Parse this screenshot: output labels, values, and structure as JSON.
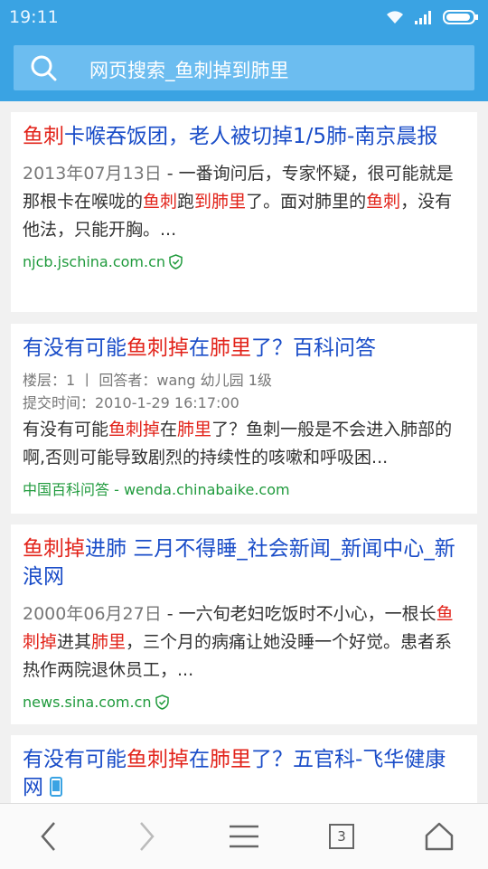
{
  "status_bar": {
    "time": "19:11",
    "icons": [
      "wifi-icon",
      "signal-icon",
      "battery-icon"
    ]
  },
  "search": {
    "query": "网页搜索_鱼刺掉到肺里",
    "icon": "search-icon"
  },
  "results": [
    {
      "title_segments": [
        {
          "text": "鱼刺",
          "hl": true
        },
        {
          "text": "卡喉吞饭团，老人被切掉1/5肺-南京晨报",
          "hl": false
        }
      ],
      "date": "2013年07月13日",
      "snippet_segments": [
        {
          "text": " - 一番询问后，专家怀疑，很可能就是那根卡在喉咙的",
          "hl": false
        },
        {
          "text": "鱼刺",
          "hl": true
        },
        {
          "text": "跑",
          "hl": false
        },
        {
          "text": "到肺里",
          "hl": true
        },
        {
          "text": "了。面对肺里的",
          "hl": false
        },
        {
          "text": "鱼刺",
          "hl": true
        },
        {
          "text": "，没有他法，只能开胸。...",
          "hl": false
        }
      ],
      "source": "njcb.jschina.com.cn",
      "verified": true
    },
    {
      "title_segments": [
        {
          "text": "有没有可能",
          "hl": false
        },
        {
          "text": "鱼刺掉",
          "hl": true
        },
        {
          "text": "在",
          "hl": false
        },
        {
          "text": "肺里",
          "hl": true
        },
        {
          "text": "了？百科问答",
          "hl": false
        }
      ],
      "meta_line1": "楼层：1 丨 回答者：wang 幼儿园 1级",
      "meta_line2": "提交时间：2010-1-29 16:17:00",
      "snippet_segments": [
        {
          "text": "有没有可能",
          "hl": false
        },
        {
          "text": "鱼刺掉",
          "hl": true
        },
        {
          "text": "在",
          "hl": false
        },
        {
          "text": "肺里",
          "hl": true
        },
        {
          "text": "了？鱼刺一般是不会进入肺部的啊,否则可能导致剧烈的持续性的咳嗽和呼吸困...",
          "hl": false
        }
      ],
      "source": "中国百科问答 - wenda.chinabaike.com",
      "verified": false
    },
    {
      "title_segments": [
        {
          "text": "鱼刺掉",
          "hl": true
        },
        {
          "text": "进肺 三月不得睡_社会新闻_新闻中心_新浪网",
          "hl": false
        }
      ],
      "date": "2000年06月27日",
      "snippet_segments": [
        {
          "text": " - 一六旬老妇吃饭时不小心，一根长",
          "hl": false
        },
        {
          "text": "鱼刺掉",
          "hl": true
        },
        {
          "text": "进其",
          "hl": false
        },
        {
          "text": "肺里",
          "hl": true
        },
        {
          "text": "，三个月的病痛让她没睡一个好觉。患者系热作两院退休员工，...",
          "hl": false
        }
      ],
      "source": "news.sina.com.cn",
      "verified": true
    },
    {
      "title_segments": [
        {
          "text": "有没有可能",
          "hl": false
        },
        {
          "text": "鱼刺掉",
          "hl": true
        },
        {
          "text": "在",
          "hl": false
        },
        {
          "text": "肺里",
          "hl": true
        },
        {
          "text": "了？五官科-飞华健康网",
          "hl": false
        }
      ],
      "mobile_badge": "mobile-icon"
    }
  ],
  "bottom_nav": {
    "back": "back-icon",
    "forward": "forward-icon",
    "menu": "menu-icon",
    "tab_count": "3",
    "home": "home-icon"
  },
  "colors": {
    "header": "#3aa3e3",
    "title": "#1a4dc8",
    "highlight": "#e2231a",
    "source": "#1f9a3c"
  }
}
